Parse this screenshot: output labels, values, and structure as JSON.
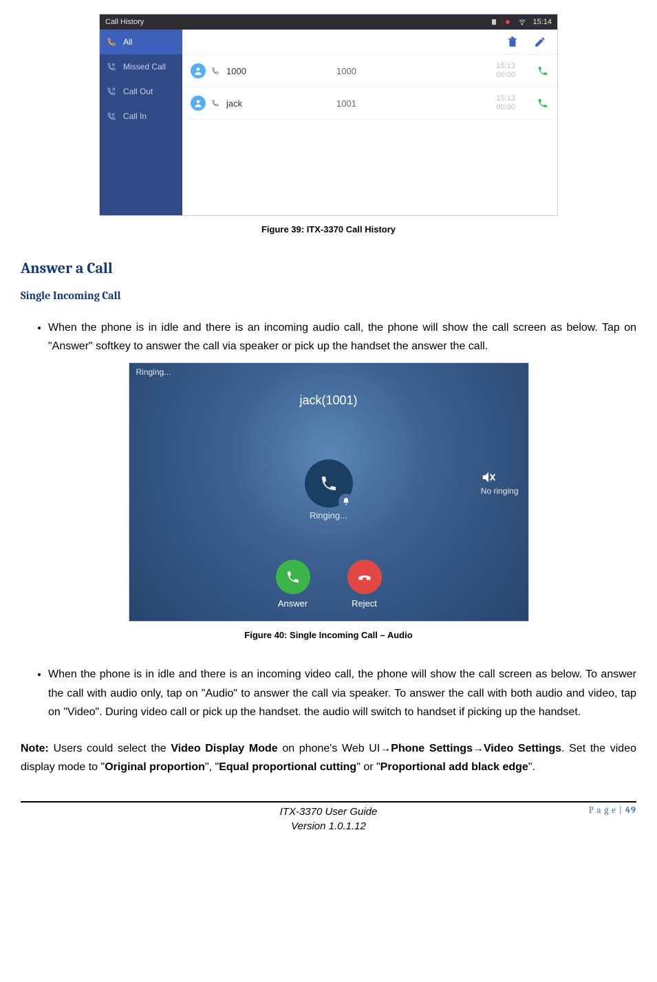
{
  "fig39": {
    "statusbar_title": "Call History",
    "status_time": "15:14",
    "sidebar": [
      {
        "label": "All",
        "active": true
      },
      {
        "label": "Missed Call",
        "active": false
      },
      {
        "label": "Call Out",
        "active": false
      },
      {
        "label": "Call In",
        "active": false
      }
    ],
    "rows": [
      {
        "name": "1000",
        "ext": "1000",
        "time": "15:13",
        "duration": "00:00"
      },
      {
        "name": "jack",
        "ext": "1001",
        "time": "15:13",
        "duration": "00:00"
      }
    ],
    "caption": "Figure 39: ITX-3370 Call History"
  },
  "section": {
    "h2": "Answer a Call",
    "h3": "Single Incoming Call",
    "bullet1": "When the phone is in idle and there is an incoming audio call, the phone will show the call screen as below. Tap on \"Answer\" softkey to answer the call via speaker or pick up the handset the answer the call.",
    "bullet2": "When the phone is in idle and there is an incoming video call, the phone will show the call screen as below. To answer the call with audio only, tap on \"Audio\" to answer the call via speaker. To answer the call with both audio and video, tap on \"Video\". During video call or pick up the handset. the audio will switch to handset if picking up the handset."
  },
  "fig40": {
    "ringing_top": "Ringing...",
    "caller": "jack(1001)",
    "no_ringing": "No ringing",
    "ringing_center": "Ringing...",
    "answer": "Answer",
    "reject": "Reject",
    "caption": "Figure 40: Single Incoming Call – Audio"
  },
  "note": {
    "prefix": "Note:",
    "t1": " Users could select the ",
    "b1": "Video Display Mode",
    "t2": " on phone's Web UI",
    "arrow1": "→",
    "b2": "Phone Settings",
    "arrow2": "→",
    "b3": "Video Settings",
    "t3": ". Set the video display mode to \"",
    "b4": "Original proportion",
    "t4": "\", \"",
    "b5": "Equal proportional cutting",
    "t5": "\" or \"",
    "b6": "Proportional add black edge",
    "t6": "\"."
  },
  "footer": {
    "line1": "ITX-3370 User Guide",
    "line2": "Version 1.0.1.12",
    "page_label": "P a g e | ",
    "page_num": "49"
  }
}
